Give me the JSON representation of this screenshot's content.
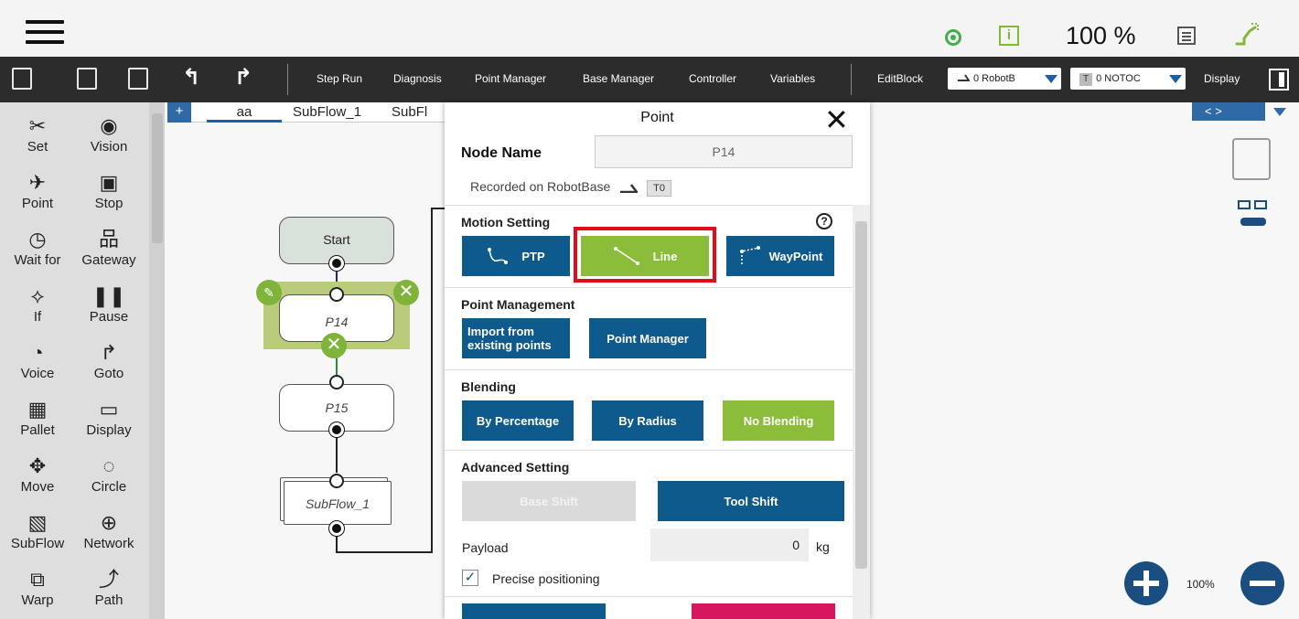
{
  "status": {
    "speed": "100 %",
    "info_glyph": "i",
    "icons": [
      "hamburger-menu-icon",
      "eye-icon",
      "info-icon",
      "log-icon",
      "robot-connection-icon"
    ]
  },
  "toolbar": {
    "items": [
      "Step Run",
      "Diagnosis",
      "Point Manager",
      "Base Manager",
      "Controller",
      "Variables"
    ],
    "editblock": "EditBlock",
    "base_dropdown": "0 RobotB",
    "tool_badge": "T",
    "tool_dropdown": "0 NOTOC",
    "display": "Display"
  },
  "palette": {
    "items": [
      "Set",
      "Vision",
      "Point",
      "Stop",
      "Wait for",
      "Gateway",
      "If",
      "Pause",
      "Voice",
      "Goto",
      "Pallet",
      "Display",
      "Move",
      "Circle",
      "SubFlow",
      "Network",
      "Warp",
      "Path"
    ]
  },
  "canvas": {
    "tabs": [
      "aa",
      "SubFlow_1",
      "SubFl"
    ],
    "add_tab": "+",
    "nav": "< >",
    "nodes": {
      "start": "Start",
      "p14": "P14",
      "p15": "P15",
      "subflow": "SubFlow_1"
    },
    "zoom": "100%"
  },
  "dialog": {
    "title": "Point",
    "node_name_label": "Node Name",
    "node_name_value": "P14",
    "recorded_on": "Recorded on RobotBase",
    "tool_tag": "T0",
    "motion_setting": "Motion Setting",
    "motion_buttons": [
      "PTP",
      "Line",
      "WayPoint"
    ],
    "point_management": "Point Management",
    "import_button": "Import from existing points",
    "point_manager_button": "Point Manager",
    "blending": "Blending",
    "blending_buttons": [
      "By Percentage",
      "By Radius",
      "No Blending"
    ],
    "advanced_setting": "Advanced Setting",
    "base_shift": "Base Shift",
    "tool_shift": "Tool Shift",
    "payload_label": "Payload",
    "payload_value": "0",
    "payload_unit": "kg",
    "precise_positioning": "Precise positioning",
    "precise_checked": true,
    "help": "?",
    "close": "✕"
  },
  "colors": {
    "accent_blue": "#0e5a8c",
    "accent_green": "#8bbd3a",
    "highlight_red": "#e10d1a",
    "toolbar_dark": "#2c2c2c"
  }
}
